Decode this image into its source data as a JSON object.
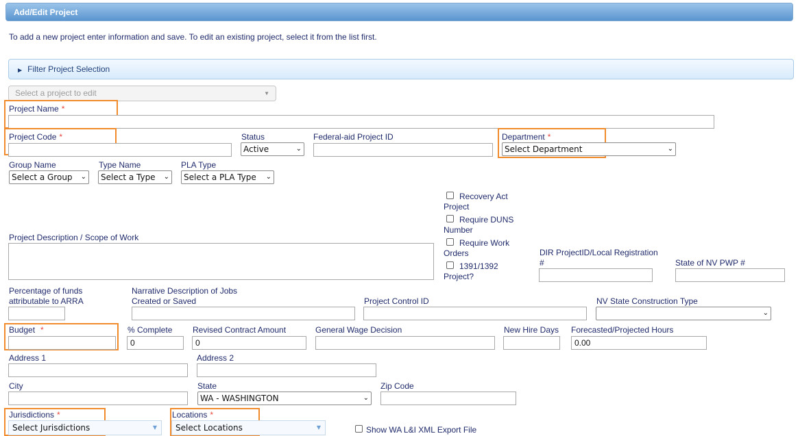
{
  "header": {
    "title": "Add/Edit Project"
  },
  "intro": "To add a new project enter information and save. To edit an existing project, select it from the list first.",
  "filter": {
    "label": "Filter Project Selection"
  },
  "project_select": {
    "placeholder": "Select a project to edit"
  },
  "required_mark": "*",
  "fields": {
    "project_name": {
      "label": "Project Name",
      "value": ""
    },
    "project_code": {
      "label": "Project Code",
      "value": ""
    },
    "status": {
      "label": "Status",
      "value": "Active"
    },
    "federal_aid": {
      "label": "Federal-aid Project ID",
      "value": ""
    },
    "department": {
      "label": "Department",
      "value": "Select Department"
    },
    "group_name": {
      "label": "Group Name",
      "value": "Select a Group"
    },
    "type_name": {
      "label": "Type Name",
      "value": "Select a Type"
    },
    "pla_type": {
      "label": "PLA Type",
      "value": "Select a PLA Type"
    },
    "description": {
      "label": "Project Description / Scope of Work"
    },
    "recovery_act": {
      "label1": "Recovery Act",
      "label2": "Project"
    },
    "require_duns": {
      "label1": "Require DUNS",
      "label2": "Number"
    },
    "require_work_orders": {
      "label1": "Require Work",
      "label2": "Orders"
    },
    "project_1391": {
      "label1": "1391/1392",
      "label2": "Project?"
    },
    "dir_project": {
      "label1": "DIR ProjectID/Local Registration",
      "label2": "#"
    },
    "nv_pwp": {
      "label": "State of NV PWP #"
    },
    "arra_pct": {
      "label1": "Percentage of funds",
      "label2": "attributable to ARRA"
    },
    "narrative": {
      "label1": "Narrative Description of Jobs",
      "label2": "Created or Saved"
    },
    "control_id": {
      "label": "Project Control ID"
    },
    "nv_construction": {
      "label": "NV State Construction Type",
      "value": ""
    },
    "budget": {
      "label": "Budget",
      "value": ""
    },
    "pct_complete": {
      "label": "% Complete",
      "value": "0"
    },
    "revised_amount": {
      "label": "Revised Contract Amount",
      "value": "0"
    },
    "wage_decision": {
      "label": "General Wage Decision",
      "value": ""
    },
    "new_hire_days": {
      "label": "New Hire Days",
      "value": ""
    },
    "forecast_hours": {
      "label": "Forecasted/Projected Hours",
      "value": "0.00"
    },
    "address1": {
      "label": "Address 1"
    },
    "address2": {
      "label": "Address 2"
    },
    "city": {
      "label": "City"
    },
    "state": {
      "label": "State",
      "value": "WA - WASHINGTON"
    },
    "zip": {
      "label": "Zip Code"
    },
    "jurisdictions": {
      "label": "Jurisdictions",
      "value": "Select Jurisdictions"
    },
    "locations": {
      "label": "Locations",
      "value": "Select Locations"
    },
    "xml_export": {
      "label": "Show WA L&I XML Export File"
    }
  },
  "colors": {
    "accent": "#5a95cf",
    "highlight": "#f08a2b",
    "required": "#e8453c",
    "label": "#1f2a6b"
  }
}
